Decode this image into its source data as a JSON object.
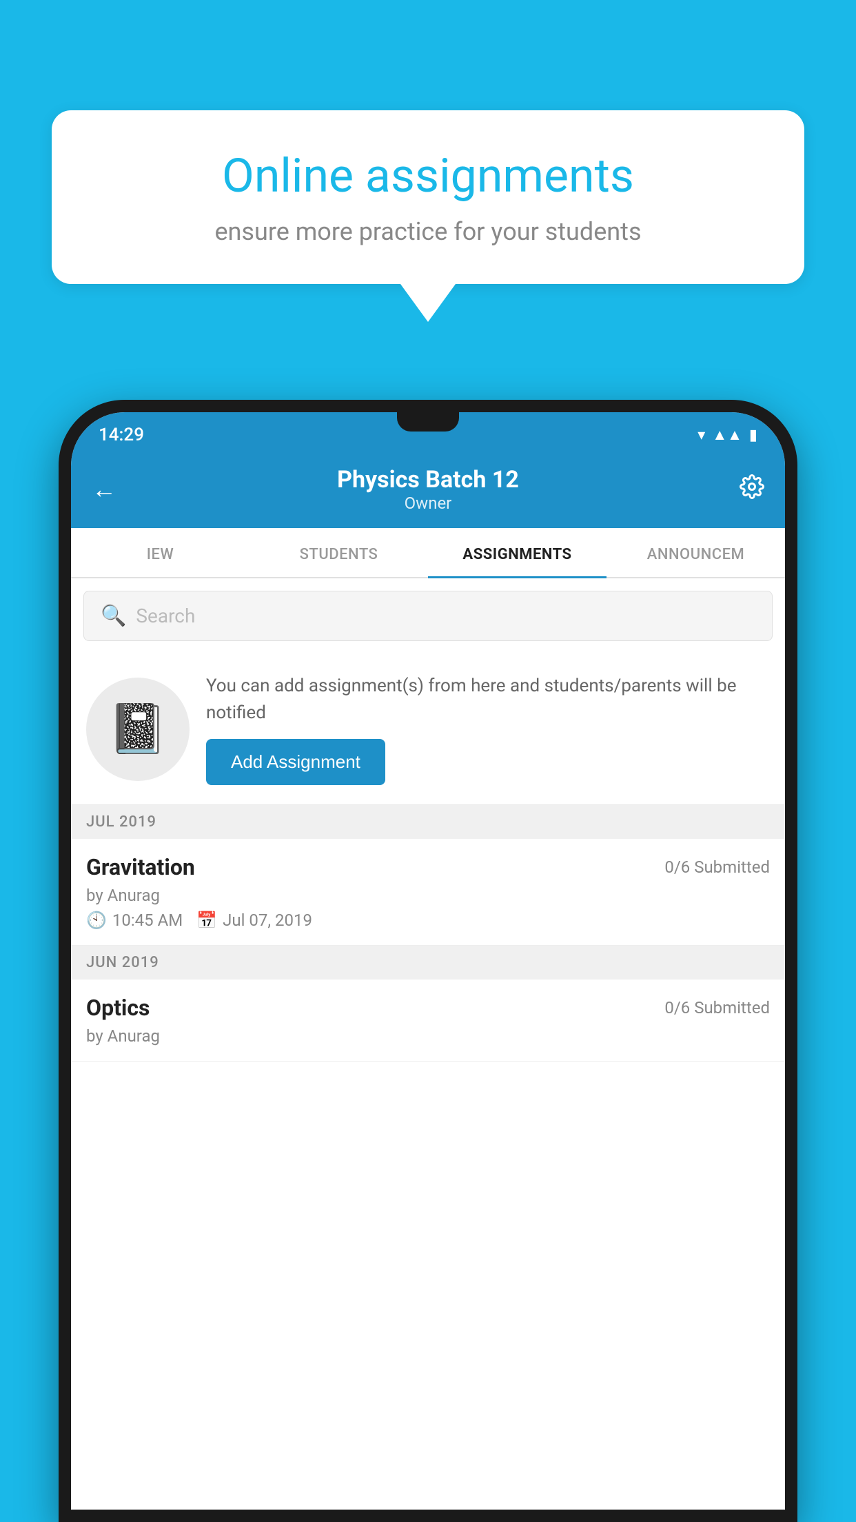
{
  "background": {
    "color": "#1ab8e8"
  },
  "speechBubble": {
    "title": "Online assignments",
    "subtitle": "ensure more practice for your students"
  },
  "statusBar": {
    "time": "14:29",
    "icons": [
      "wifi",
      "signal",
      "battery"
    ]
  },
  "header": {
    "title": "Physics Batch 12",
    "subtitle": "Owner",
    "backLabel": "←",
    "settingsLabel": "⚙"
  },
  "tabs": [
    {
      "label": "IEW",
      "active": false
    },
    {
      "label": "STUDENTS",
      "active": false
    },
    {
      "label": "ASSIGNMENTS",
      "active": true
    },
    {
      "label": "ANNOUNCEM",
      "active": false
    }
  ],
  "search": {
    "placeholder": "Search"
  },
  "promo": {
    "text": "You can add assignment(s) from here and students/parents will be notified",
    "buttonLabel": "Add Assignment"
  },
  "monthGroups": [
    {
      "month": "JUL 2019",
      "assignments": [
        {
          "title": "Gravitation",
          "status": "0/6 Submitted",
          "by": "by Anurag",
          "time": "10:45 AM",
          "date": "Jul 07, 2019"
        }
      ]
    },
    {
      "month": "JUN 2019",
      "assignments": [
        {
          "title": "Optics",
          "status": "0/6 Submitted",
          "by": "by Anurag",
          "time": "",
          "date": ""
        }
      ]
    }
  ]
}
